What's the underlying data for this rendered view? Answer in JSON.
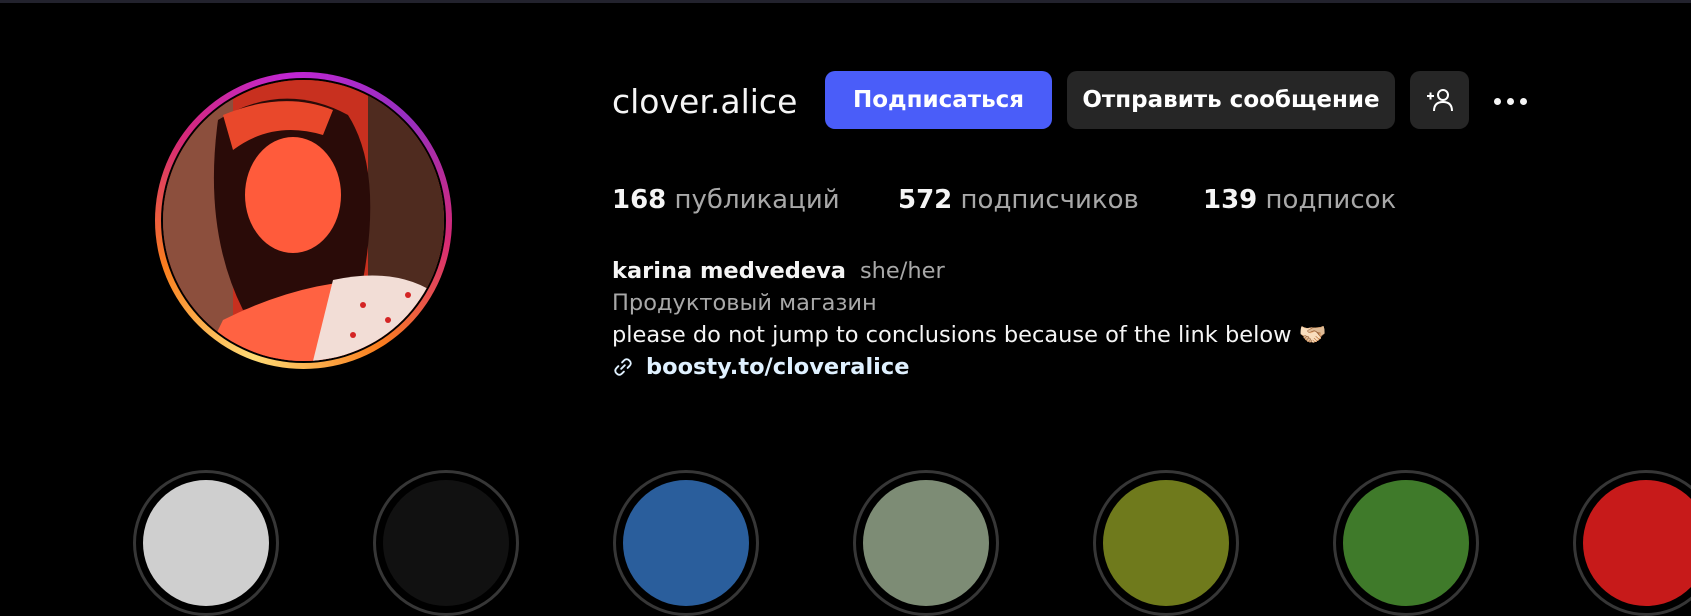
{
  "profile": {
    "username": "clover.alice",
    "follow_label": "Подписаться",
    "message_label": "Отправить сообщение",
    "add_user_icon": "person-add-icon",
    "more_icon": "more-options-icon"
  },
  "stats": [
    {
      "number": "168",
      "label": "публикаций"
    },
    {
      "number": "572",
      "label": "подписчиков"
    },
    {
      "number": "139",
      "label": "подписок"
    }
  ],
  "bio": {
    "name": "karina medvedeva",
    "pronouns": "she/her",
    "category": "Продуктовый магазин",
    "text": "please do not jump to conclusions because of the link below 🫱🏻‍🫲🏼",
    "link": "boosty.to/cloveralice",
    "link_icon": "link-icon"
  },
  "highlights": [
    {
      "color": "#cfcfcf"
    },
    {
      "color": "#111111"
    },
    {
      "color": "#2a5e9c"
    },
    {
      "color": "#7d8c75"
    },
    {
      "color": "#6f7a1c"
    },
    {
      "color": "#3f7a2a"
    },
    {
      "color": "#c71a1a"
    }
  ],
  "colors": {
    "accent": "#4a5df9",
    "button_secondary": "#262626",
    "muted_text": "#a8a8a8"
  }
}
